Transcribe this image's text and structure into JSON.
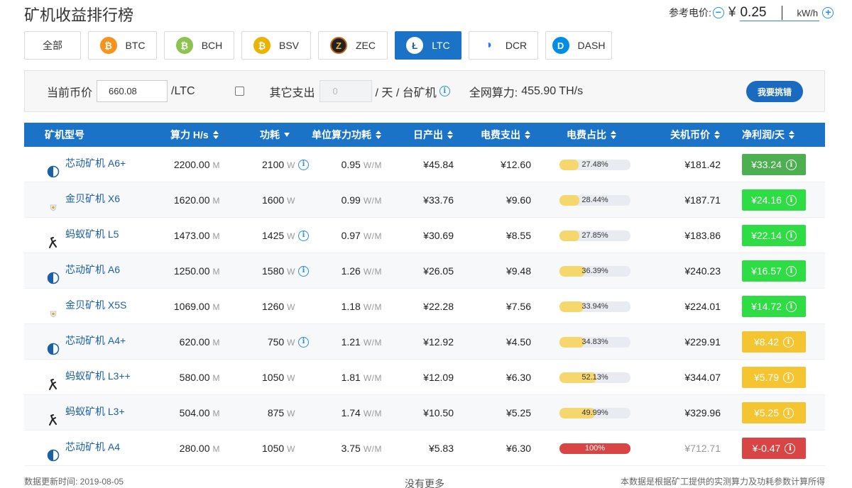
{
  "title": "矿机收益排行榜",
  "price_ref": {
    "label": "参考电价:",
    "minus_icon": "minus-circle-icon",
    "currency": "¥",
    "value": "0.25",
    "unit": "kW/h",
    "plus_icon": "plus-circle-icon"
  },
  "coins": [
    {
      "label": "全部",
      "icon": "",
      "color": ""
    },
    {
      "label": "BTC",
      "icon": "bitcoin-icon",
      "color": "#f7931a"
    },
    {
      "label": "BCH",
      "icon": "bitcoin-cash-icon",
      "color": "#8dc351"
    },
    {
      "label": "BSV",
      "icon": "bitcoin-sv-icon",
      "color": "#eab300"
    },
    {
      "label": "ZEC",
      "icon": "zcash-icon",
      "color": "#c46a21"
    },
    {
      "label": "LTC",
      "icon": "litecoin-icon",
      "color": "#1a5fa8",
      "active": true
    },
    {
      "label": "DCR",
      "icon": "decred-icon",
      "color": "#2ed8a3"
    },
    {
      "label": "DASH",
      "icon": "dash-icon",
      "color": "#008de4"
    }
  ],
  "filter": {
    "price_label": "当前币价",
    "price_value": "660.08",
    "price_unit": "/LTC",
    "other_label": "其它支出",
    "other_placeholder": "0",
    "other_unit": "/ 天 / 台矿机",
    "network_label": "全网算力:",
    "network_value": "455.90 TH/s",
    "report_button": "我要挑错"
  },
  "columns": {
    "model": "矿机型号",
    "hashrate": "算力 H/s",
    "power": "功耗",
    "efficiency": "单位算力功耗",
    "daily_output": "日产出",
    "electricity": "电费支出",
    "elec_ratio": "电费占比",
    "shutdown_price": "关机币价",
    "net_profit": "净利润/天"
  },
  "units": {
    "hash": "M",
    "power": "W",
    "eff": "W/M"
  },
  "rows": [
    {
      "brand": "canaan",
      "model": "芯动矿机 A6+",
      "hashrate": "2200.00",
      "power": "2100",
      "power_info": true,
      "efficiency": "0.95",
      "output": "¥45.84",
      "fee": "¥12.60",
      "ratio": 27.48,
      "ratio_text": "27.48%",
      "shutdown": "¥181.42",
      "profit": "¥33.24",
      "profit_color": "#4caf50"
    },
    {
      "brand": "gold",
      "model": "金贝矿机 X6",
      "hashrate": "1620.00",
      "power": "1600",
      "power_info": false,
      "efficiency": "0.99",
      "output": "¥33.76",
      "fee": "¥9.60",
      "ratio": 28.44,
      "ratio_text": "28.44%",
      "shutdown": "¥187.71",
      "profit": "¥24.16",
      "profit_color": "#2edc44"
    },
    {
      "brand": "ant",
      "model": "蚂蚁矿机 L5",
      "hashrate": "1473.00",
      "power": "1425",
      "power_info": true,
      "efficiency": "0.97",
      "output": "¥30.69",
      "fee": "¥8.55",
      "ratio": 27.85,
      "ratio_text": "27.85%",
      "shutdown": "¥183.86",
      "profit": "¥22.14",
      "profit_color": "#2edc44"
    },
    {
      "brand": "canaan",
      "model": "芯动矿机 A6",
      "hashrate": "1250.00",
      "power": "1580",
      "power_info": true,
      "efficiency": "1.26",
      "output": "¥26.05",
      "fee": "¥9.48",
      "ratio": 36.39,
      "ratio_text": "36.39%",
      "shutdown": "¥240.23",
      "profit": "¥16.57",
      "profit_color": "#2edc44"
    },
    {
      "brand": "gold",
      "model": "金贝矿机 X5S",
      "hashrate": "1069.00",
      "power": "1260",
      "power_info": false,
      "efficiency": "1.18",
      "output": "¥22.28",
      "fee": "¥7.56",
      "ratio": 33.94,
      "ratio_text": "33.94%",
      "shutdown": "¥224.01",
      "profit": "¥14.72",
      "profit_color": "#2edc44"
    },
    {
      "brand": "canaan",
      "model": "芯动矿机 A4+",
      "hashrate": "620.00",
      "power": "750",
      "power_info": true,
      "efficiency": "1.21",
      "output": "¥12.92",
      "fee": "¥4.50",
      "ratio": 34.83,
      "ratio_text": "34.83%",
      "shutdown": "¥229.91",
      "profit": "¥8.42",
      "profit_color": "#f5c531"
    },
    {
      "brand": "ant",
      "model": "蚂蚁矿机 L3++",
      "hashrate": "580.00",
      "power": "1050",
      "power_info": false,
      "efficiency": "1.81",
      "output": "¥12.09",
      "fee": "¥6.30",
      "ratio": 52.13,
      "ratio_text": "52.13%",
      "shutdown": "¥344.07",
      "profit": "¥5.79",
      "profit_color": "#f5c531"
    },
    {
      "brand": "ant",
      "model": "蚂蚁矿机 L3+",
      "hashrate": "504.00",
      "power": "875",
      "power_info": false,
      "efficiency": "1.74",
      "output": "¥10.50",
      "fee": "¥5.25",
      "ratio": 49.99,
      "ratio_text": "49.99%",
      "shutdown": "¥329.96",
      "profit": "¥5.25",
      "profit_color": "#f5c531"
    },
    {
      "brand": "canaan",
      "model": "芯动矿机 A4",
      "hashrate": "280.00",
      "power": "1050",
      "power_info": false,
      "efficiency": "3.75",
      "output": "¥5.83",
      "fee": "¥6.30",
      "ratio": 100,
      "ratio_text": "100%",
      "shutdown": "¥712.71",
      "shutdown_gray": true,
      "profit": "¥-0.47",
      "profit_color": "#d94545"
    }
  ],
  "footer": {
    "update_time": "数据更新时间: 2019-08-05",
    "no_more": "没有更多",
    "note": "本数据是根据矿工提供的实测算力及功耗参数计算所得"
  }
}
